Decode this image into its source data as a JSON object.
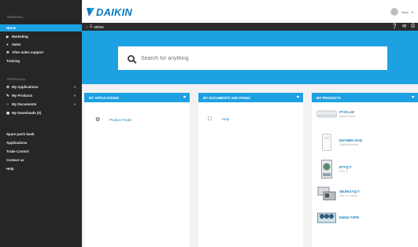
{
  "brand": {
    "name": "DAIKIN"
  },
  "user": {
    "name": "Marc"
  },
  "menubar": {
    "menu_label": "MENU"
  },
  "search": {
    "placeholder": "Search for anything"
  },
  "sidebar": {
    "general_heading": "GENERAL",
    "general": [
      {
        "label": "Home",
        "icon": ""
      },
      {
        "label": "Marketing",
        "icon": "megaphone-icon"
      },
      {
        "label": "Sales",
        "icon": "tag-icon"
      },
      {
        "label": "After-sales support",
        "icon": "tools-icon"
      },
      {
        "label": "Training",
        "icon": ""
      }
    ],
    "personal_heading": "PERSONAL",
    "personal": [
      {
        "label": "My Applications",
        "icon": "gear-icon"
      },
      {
        "label": "My Products",
        "icon": "wrench-icon"
      },
      {
        "label": "My Documents",
        "icon": "document-icon"
      },
      {
        "label": "My Downloads (0)",
        "icon": "cart-icon"
      }
    ],
    "links": [
      "Spare parts bank",
      "Applications",
      "Trade Control",
      "Contact us",
      "Help"
    ]
  },
  "cards": {
    "applications": {
      "title": "MY APPLICATIONS",
      "items": [
        "Product Finder"
      ]
    },
    "documents": {
      "title": "MY DOCUMENTS AND PAGES",
      "items": [
        "Help"
      ]
    },
    "products": {
      "title": "MY PRODUCTS",
      "items": [
        {
          "name": "FTXG-LW",
          "sub": "Daikin Emura"
        },
        {
          "name": "EHYHBH-AV32",
          "sub": "Daikin Altherma"
        },
        {
          "name": "RTYQ-T",
          "sub": "VRV IV"
        },
        {
          "name": "SB.RKXYQ-T",
          "sub": "VRV IV i-series"
        },
        {
          "name": "EWAD-TZPR",
          "sub": ""
        }
      ]
    }
  },
  "colors": {
    "accent": "#1da1e2",
    "sidebar": "#262626",
    "active": "#1ba0e1",
    "link": "#1a7fc4"
  }
}
